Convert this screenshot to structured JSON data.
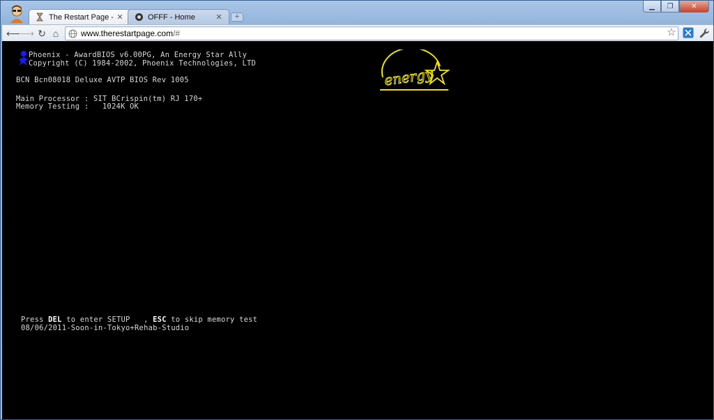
{
  "tabs": [
    {
      "label": "The Restart Page - Free unli",
      "active": true
    },
    {
      "label": "OFFF - Home",
      "active": false
    }
  ],
  "toolbar": {
    "url_host": "www.therestartpage.com",
    "url_rest": "/#"
  },
  "bios": {
    "line1": "Phoenix - AwardBIOS v6.00PG, An Energy Star Ally",
    "line2": "Copyright (C) 1984-2002, Phoenix Technologies, LTD",
    "line3": "BCN Bcn08018 Deluxe AVTP BIOS Rev 1005",
    "line4": "Main Processor : SIT BCrispin(tm) RJ 170+",
    "line5": "Memory Testing :   1024K OK",
    "press_prefix": "Press ",
    "del_key": "DEL",
    "press_mid": " to enter SETUP   , ",
    "esc_key": "ESC",
    "press_suffix": " to skip memory test",
    "line7": "08/06/2011-Soon-in-Tokyo+Rehab-Studio",
    "energy_logo_text": "energy"
  },
  "colors": {
    "screen_bg": "#000000",
    "bios_text": "#d8d8d8",
    "energy_star": "#f2e600",
    "award_logo": "#1a1aff"
  },
  "icons": {
    "back": "back-arrow-icon",
    "forward": "forward-arrow-icon",
    "reload": "reload-icon",
    "home": "home-icon",
    "bookmark": "star-icon",
    "settings": "wrench-icon"
  }
}
